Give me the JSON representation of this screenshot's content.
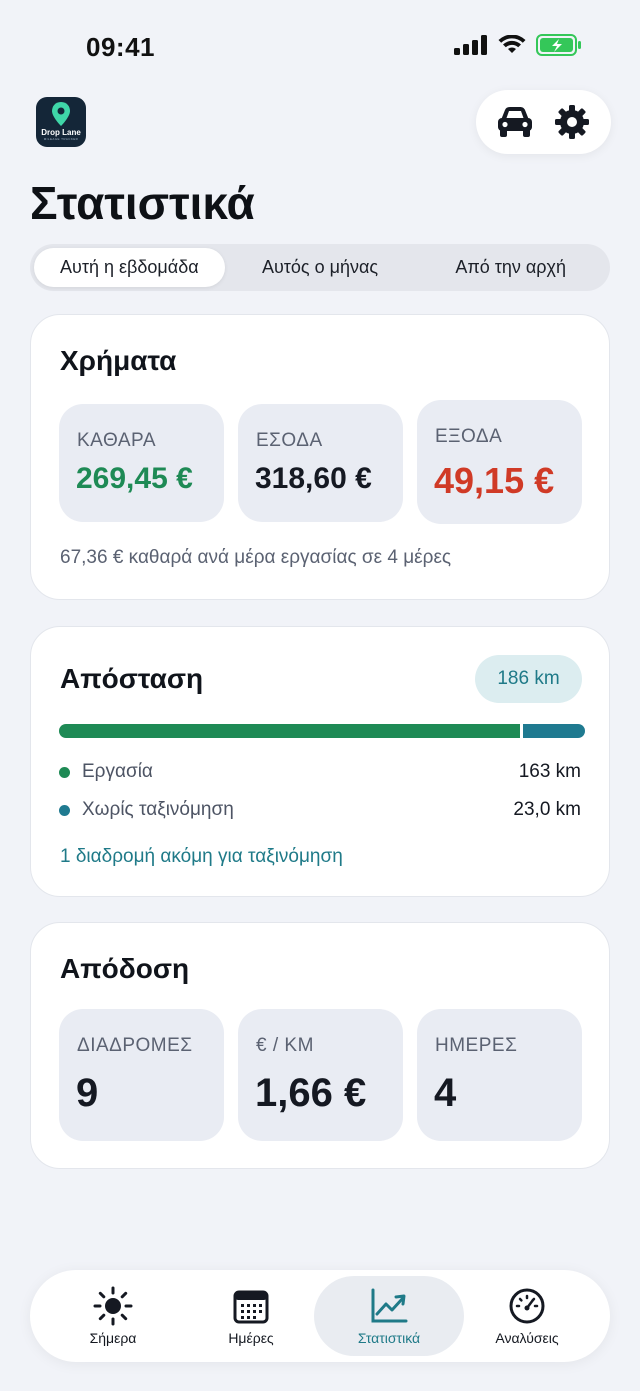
{
  "status": {
    "time": "09:41"
  },
  "app": {
    "logo_name": "Drop Lane",
    "logo_tagline": "MILEAGE TRACKER"
  },
  "header": {
    "title": "Στατιστικά"
  },
  "tabs": [
    {
      "label": "Αυτή η εβδομάδα",
      "active": true
    },
    {
      "label": "Αυτός ο μήνας",
      "active": false
    },
    {
      "label": "Από την αρχή",
      "active": false
    }
  ],
  "money": {
    "title": "Χρήματα",
    "net_label": "ΚΑΘΑΡΑ",
    "net_value": "269,45 €",
    "income_label": "ΕΣΟΔΑ",
    "income_value": "318,60 €",
    "expenses_label": "ΕΞΟΔΑ",
    "expenses_value": "49,15 €",
    "note": "67,36 € καθαρά ανά μέρα εργασίας σε 4 μέρες"
  },
  "distance": {
    "title": "Απόσταση",
    "total": "186 km",
    "work_fraction": 0.876,
    "work_label": "Εργασία",
    "work_value": "163 km",
    "unclassified_label": "Χωρίς ταξινόμηση",
    "unclassified_value": "23,0 km",
    "classify_link": "1 διαδρομή ακόμη για ταξινόμηση"
  },
  "performance": {
    "title": "Απόδοση",
    "trips_label": "ΔΙΑΔΡΟΜΕΣ",
    "trips_value": "9",
    "per_km_label": "€ / KM",
    "per_km_value": "1,66 €",
    "days_label": "ΗΜΕΡΕΣ",
    "days_value": "4"
  },
  "colors": {
    "positive": "#1e8a55",
    "negative": "#d03a26",
    "accent": "#1f7a88",
    "unclassified": "#1f7a90"
  },
  "nav": [
    {
      "label": "Σήμερα",
      "icon": "sun-icon",
      "active": false
    },
    {
      "label": "Ημέρες",
      "icon": "calendar-icon",
      "active": false
    },
    {
      "label": "Στατιστικά",
      "icon": "chart-icon",
      "active": true
    },
    {
      "label": "Αναλύσεις",
      "icon": "gauge-icon",
      "active": false
    }
  ]
}
